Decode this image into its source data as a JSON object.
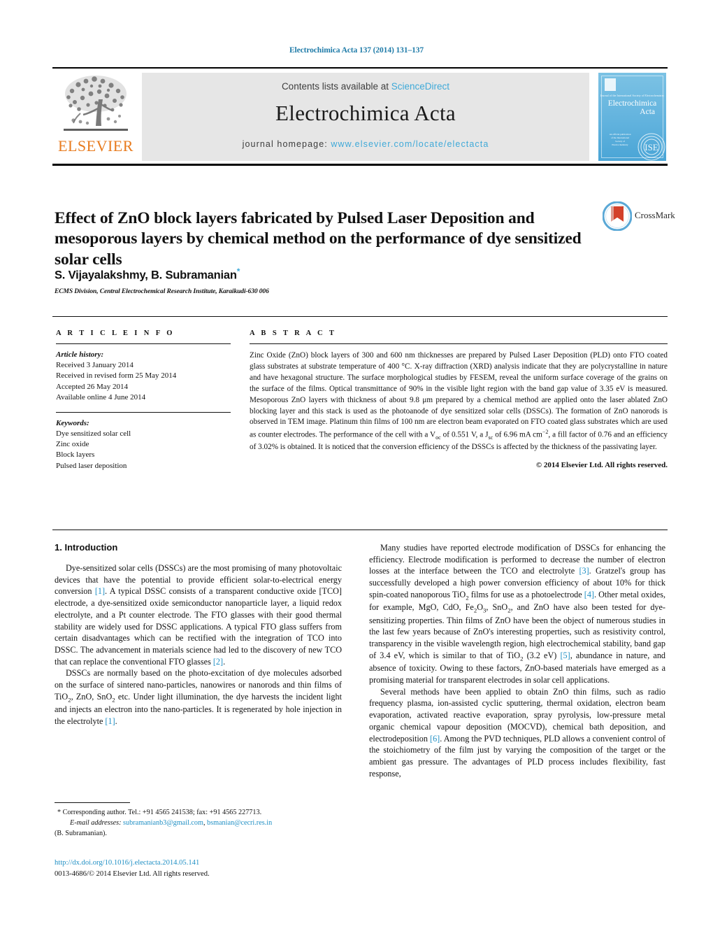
{
  "running_head": "Electrochimica Acta 137 (2014) 131–137",
  "masthead": {
    "contents_prefix": "Contents lists available at ",
    "sciencedirect": "ScienceDirect",
    "journal_name": "Electrochimica Acta",
    "homepage_prefix": "journal homepage: ",
    "homepage_url": "www.elsevier.com/locate/electacta",
    "publisher_logo_text": "ELSEVIER",
    "cover": {
      "tagline": "Journal of the International Society of Electrochemistry",
      "title_line1": "Electrochimica",
      "title_line2": "Acta",
      "small_block": "An official publication of the International Society of Electrochemistry",
      "society_mark": "ISE"
    }
  },
  "title": "Effect of ZnO block layers fabricated by Pulsed Laser Deposition and mesoporous layers by chemical method on the performance of dye sensitized solar cells",
  "crossmark_label": "CrossMark",
  "authors": "S. Vijayalakshmy, B. Subramanian",
  "author_star": "*",
  "affiliation": "ECMS Division, Central Electrochemical Research Institute, Karaikudi-630 006",
  "article_info": {
    "heading": "A R T I C L E   I N F O",
    "history_label": "Article history:",
    "history": [
      "Received 3 January 2014",
      "Received in revised form 25 May 2014",
      "Accepted 26 May 2014",
      "Available online 4 June 2014"
    ],
    "keywords_label": "Keywords:",
    "keywords": [
      "Dye sensitized solar cell",
      "Zinc oxide",
      "Block layers",
      "Pulsed laser deposition"
    ]
  },
  "abstract": {
    "heading": "A B S T R A C T",
    "text": "Zinc Oxide (ZnO) block layers of 300 and 600 nm thicknesses are prepared by Pulsed Laser Deposition (PLD) onto FTO coated glass substrates at substrate temperature of 400 °C. X-ray diffraction (XRD) analysis indicate that they are polycrystalline in nature and have hexagonal structure. The surface morphological studies by FESEM, reveal the uniform surface coverage of the grains on the surface of the films. Optical transmittance of 90% in the visible light region with the band gap value of 3.35 eV is measured. Mesoporous ZnO layers with thickness of about 9.8 μm prepared by a chemical method are applied onto the laser ablated ZnO blocking layer and this stack is used as the photoanode of dye sensitized solar cells (DSSCs). The formation of ZnO nanorods is observed in TEM image. Platinum thin films of 100 nm are electron beam evaporated on FTO coated glass substrates which are used as counter electrodes. The performance of the cell with a Voc of 0.551 V, a Jsc of 6.96 mA cm−2, a fill factor of 0.76 and an efficiency of 3.02% is obtained. It is noticed that the conversion efficiency of the DSSCs is affected by the thickness of the passivating layer.",
    "copyright": "© 2014 Elsevier Ltd. All rights reserved."
  },
  "body": {
    "section_number_title": "1. Introduction",
    "left_paragraphs": [
      "Dye-sensitized solar cells (DSSCs) are the most promising of many photovoltaic devices that have the potential to provide efficient solar-to-electrical energy conversion [1]. A typical DSSC consists of a transparent conductive oxide [TCO] electrode, a dye-sensitized oxide semiconductor nanoparticle layer, a liquid redox electrolyte, and a Pt counter electrode. The FTO glasses with their good thermal stability are widely used for DSSC applications. A typical FTO glass suffers from certain disadvantages which can be rectified with the integration of TCO into DSSC. The advancement in materials science had led to the discovery of new TCO that can replace the conventional FTO glasses [2].",
      "DSSCs are normally based on the photo-excitation of dye molecules adsorbed on the surface of sintered nano-particles, nanowires or nanorods and thin films of TiO2, ZnO, SnO2 etc. Under light illumination, the dye harvests the incident light and injects an electron into the nano-particles. It is regenerated by hole injection in the electrolyte [1]."
    ],
    "right_paragraphs": [
      "Many studies have reported electrode modification of DSSCs for enhancing the efficiency. Electrode modification is performed to decrease the number of electron losses at the interface between the TCO and electrolyte [3]. Gratzel's group has successfully developed a high power conversion efficiency of about 10% for thick spin-coated nanoporous TiO2 films for use as a photoelectrode [4]. Other metal oxides, for example, MgO, CdO, Fe2O3, SnO2, and ZnO have also been tested for dye-sensitizing properties. Thin films of ZnO have been the object of numerous studies in the last few years because of ZnO's interesting properties, such as resistivity control, transparency in the visible wavelength region, high electrochemical stability, band gap of 3.4 eV, which is similar to that of TiO2 (3.2 eV) [5], abundance in nature, and absence of toxicity. Owing to these factors, ZnO-based materials have emerged as a promising material for transparent electrodes in solar cell applications.",
      "Several methods have been applied to obtain ZnO thin films, such as radio frequency plasma, ion-assisted cyclic sputtering, thermal oxidation, electron beam evaporation, activated reactive evaporation, spray pyrolysis, low-pressure metal organic chemical vapour deposition (MOCVD), chemical bath deposition, and electrodeposition [6]. Among the PVD techniques, PLD allows a convenient control of the stoichiometry of the film just by varying the composition of the target or the ambient gas pressure. The advantages of PLD process includes flexibility, fast response,"
    ]
  },
  "footnote": {
    "star": "*",
    "corresponding": "Corresponding author. Tel.: +91 4565 241538; fax: +91 4565 227713.",
    "email_label": "E-mail addresses:",
    "email1": "subramanianb3@gmail.com",
    "email2": "bsmanian@cecri.res.in",
    "email_sep": ", ",
    "attribution": "(B. Subramanian)."
  },
  "doi": {
    "url": "http://dx.doi.org/10.1016/j.electacta.2014.05.141",
    "issn_line": "0013-4686/© 2014 Elsevier Ltd. All rights reserved."
  },
  "colors": {
    "link": "#1f8fc4",
    "sciencedirect": "#3fa9d8",
    "elsevier_orange": "#e87b1e",
    "cover_blue": "#62b3de",
    "panel_grey": "#e6e6e6"
  }
}
